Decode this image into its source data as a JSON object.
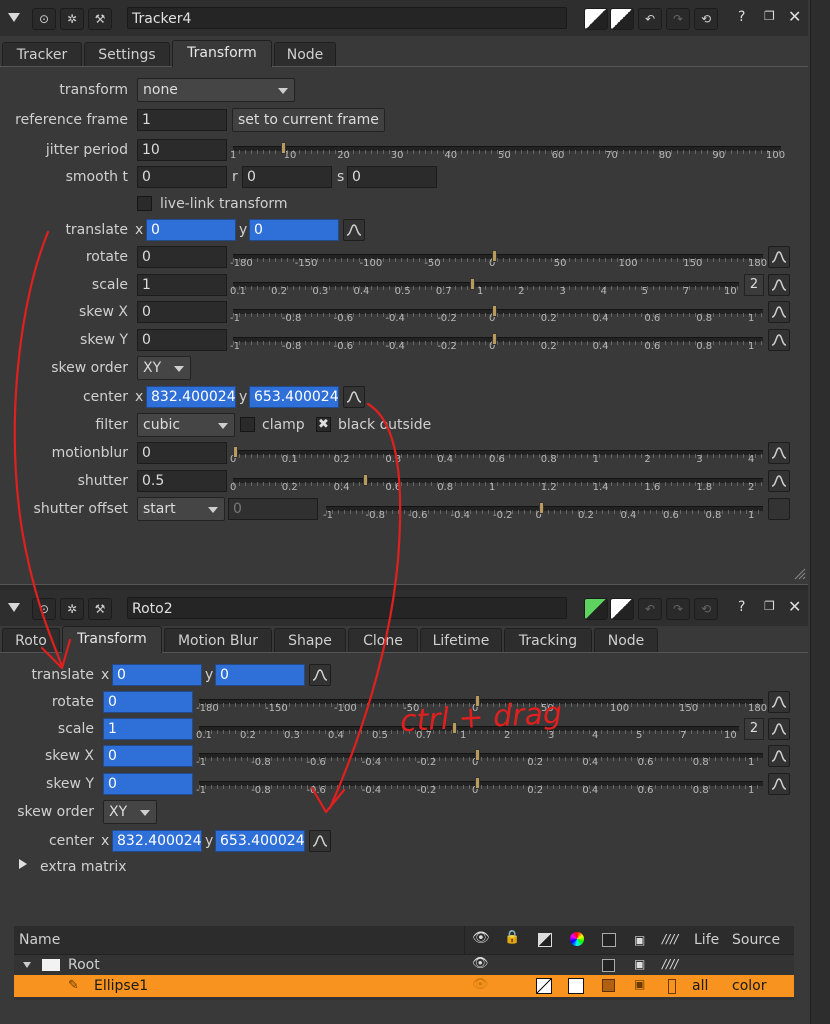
{
  "colors": {
    "accent_blue": "#2f6fd8",
    "selected_row": "#f7931e",
    "annotation": "#e0201e"
  },
  "tracker": {
    "name": "Tracker4",
    "tabs": [
      "Tracker",
      "Settings",
      "Transform",
      "Node"
    ],
    "active_tab": "Transform",
    "transform": {
      "label": "transform",
      "value": "none"
    },
    "reference_frame": {
      "label": "reference frame",
      "value": "1",
      "button": "set to current frame"
    },
    "jitter_period": {
      "label": "jitter period",
      "value": "10",
      "ticks": [
        "1",
        "10",
        "20",
        "30",
        "40",
        "50",
        "60",
        "70",
        "80",
        "90",
        "100"
      ]
    },
    "smooth": {
      "label": "smooth t",
      "t": "0",
      "r_label": "r",
      "r": "0",
      "s_label": "s",
      "s": "0"
    },
    "live_link": {
      "label": "live-link transform"
    },
    "translate": {
      "label": "translate",
      "x_label": "x",
      "x": "0",
      "y_label": "y",
      "y": "0"
    },
    "rotate": {
      "label": "rotate",
      "value": "0",
      "ticks": [
        "-180",
        "-150",
        "-100",
        "-50",
        "0",
        "50",
        "100",
        "150",
        "180"
      ]
    },
    "scale": {
      "label": "scale",
      "value": "1",
      "ticks": [
        "0.1",
        "0.2",
        "0.3",
        "0.4",
        "0.5",
        "0.7",
        "1",
        "2",
        "3",
        "4",
        "5",
        "7",
        "10"
      ],
      "badge": "2"
    },
    "skew_x": {
      "label": "skew X",
      "value": "0",
      "ticks": [
        "-1",
        "-0.8",
        "-0.6",
        "-0.4",
        "-0.2",
        "0",
        "0.2",
        "0.4",
        "0.6",
        "0.8",
        "1"
      ]
    },
    "skew_y": {
      "label": "skew Y",
      "value": "0",
      "ticks": [
        "-1",
        "-0.8",
        "-0.6",
        "-0.4",
        "-0.2",
        "0",
        "0.2",
        "0.4",
        "0.6",
        "0.8",
        "1"
      ]
    },
    "skew_order": {
      "label": "skew order",
      "value": "XY"
    },
    "center": {
      "label": "center",
      "x_label": "x",
      "x": "832.4000244",
      "y_label": "y",
      "y": "653.4000244"
    },
    "filter": {
      "label": "filter",
      "value": "cubic",
      "clamp": "clamp",
      "black_outside": "black outside"
    },
    "motionblur": {
      "label": "motionblur",
      "value": "0",
      "ticks": [
        "0",
        "0.1",
        "0.2",
        "0.3",
        "0.4",
        "0.6",
        "0.8",
        "1",
        "2",
        "3",
        "4"
      ]
    },
    "shutter": {
      "label": "shutter",
      "value": "0.5",
      "ticks": [
        "0",
        "0.2",
        "0.4",
        "0.6",
        "0.8",
        "1",
        "1.2",
        "1.4",
        "1.6",
        "1.8",
        "2"
      ]
    },
    "shutter_offset": {
      "label": "shutter offset",
      "value": "start",
      "field": "0",
      "ticks": [
        "-1",
        "-0.8",
        "-0.6",
        "-0.4",
        "-0.2",
        "0",
        "0.2",
        "0.4",
        "0.6",
        "0.8",
        "1"
      ]
    }
  },
  "roto": {
    "name": "Roto2",
    "tabs": [
      "Roto",
      "Transform",
      "Motion Blur",
      "Shape",
      "Clone",
      "Lifetime",
      "Tracking",
      "Node"
    ],
    "active_tab": "Transform",
    "translate": {
      "label": "translate",
      "x_label": "x",
      "x": "0",
      "y_label": "y",
      "y": "0"
    },
    "rotate": {
      "label": "rotate",
      "value": "0",
      "ticks": [
        "-180",
        "-150",
        "-100",
        "-50",
        "0",
        "50",
        "100",
        "150",
        "180"
      ]
    },
    "scale": {
      "label": "scale",
      "value": "1",
      "ticks": [
        "0.1",
        "0.2",
        "0.3",
        "0.4",
        "0.5",
        "0.7",
        "1",
        "2",
        "3",
        "4",
        "5",
        "7",
        "10"
      ],
      "badge": "2"
    },
    "skew_x": {
      "label": "skew X",
      "value": "0",
      "ticks": [
        "-1",
        "-0.8",
        "-0.6",
        "-0.4",
        "-0.2",
        "0",
        "0.2",
        "0.4",
        "0.6",
        "0.8",
        "1"
      ]
    },
    "skew_y": {
      "label": "skew Y",
      "value": "0",
      "ticks": [
        "-1",
        "-0.8",
        "-0.6",
        "-0.4",
        "-0.2",
        "0",
        "0.2",
        "0.4",
        "0.6",
        "0.8",
        "1"
      ]
    },
    "skew_order": {
      "label": "skew order",
      "value": "XY"
    },
    "center": {
      "label": "center",
      "x_label": "x",
      "x": "832.4000244",
      "y_label": "y",
      "y": "653.4000244"
    },
    "extra_matrix": "extra matrix",
    "list": {
      "columns": {
        "name": "Name",
        "life": "Life",
        "source": "Source"
      },
      "rows": [
        {
          "name": "Root"
        },
        {
          "name": "Ellipse1",
          "life": "all",
          "source": "color"
        }
      ]
    }
  },
  "annotation_text": "ctrl + drag"
}
